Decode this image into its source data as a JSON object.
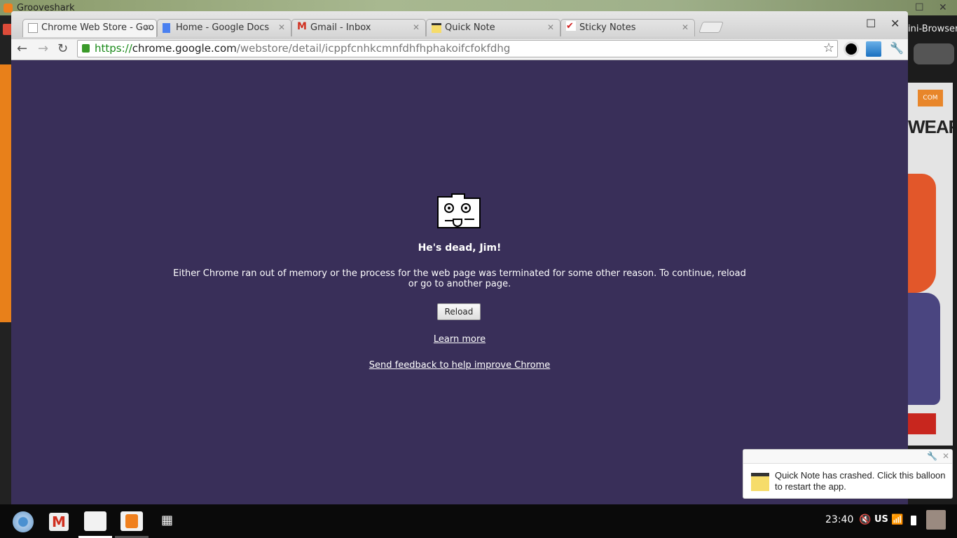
{
  "background": {
    "window_title": "Grooveshark",
    "mini_browser_label": "ini-Browser",
    "ad_text": "WEAR",
    "ad_badge": "COM"
  },
  "browser": {
    "tabs": [
      {
        "label": "Chrome Web Store - Goo",
        "active": true
      },
      {
        "label": "Home - Google Docs",
        "active": false
      },
      {
        "label": "Gmail - Inbox",
        "active": false
      },
      {
        "label": "Quick Note",
        "active": false
      },
      {
        "label": "Sticky Notes",
        "active": false
      }
    ],
    "url": {
      "scheme": "https://",
      "host": "chrome.google.com",
      "path": "/webstore/detail/icppfcnhkcmnfdhfhphakoifcfokfdhg"
    }
  },
  "crash_page": {
    "title": "He's dead, Jim!",
    "message": "Either Chrome ran out of memory or the process for the web page was terminated for some other reason. To continue, reload or go to another page.",
    "reload_label": "Reload",
    "learn_more": "Learn more",
    "feedback": "Send feedback to help improve Chrome",
    "background_color": "#392f59"
  },
  "notification": {
    "message": "Quick Note has crashed. Click this balloon to restart the app."
  },
  "taskbar": {
    "clock": "23:40",
    "keyboard_layout": "US"
  }
}
